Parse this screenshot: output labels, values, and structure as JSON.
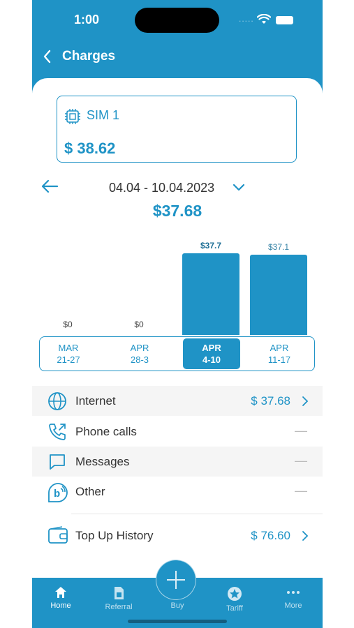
{
  "status_bar": {
    "time": "1:00",
    "dots": "....."
  },
  "header": {
    "title": "Charges"
  },
  "sim": {
    "name": "SIM 1",
    "balance": "$ 38.62"
  },
  "period": {
    "range": "04.04 - 10.04.2023",
    "total": "$37.68"
  },
  "chart_data": {
    "type": "bar",
    "categories": [
      "MAR 21-27",
      "APR 28-3",
      "APR 4-10",
      "APR 11-17"
    ],
    "values": [
      0,
      0,
      37.7,
      37.1
    ],
    "value_labels": [
      "$0",
      "$0",
      "$37.7",
      "$37.1"
    ],
    "selected_index": 2,
    "ylim": [
      0,
      37.7
    ]
  },
  "weeks": [
    {
      "month": "MAR",
      "days": "21-27"
    },
    {
      "month": "APR",
      "days": "28-3"
    },
    {
      "month": "APR",
      "days": "4-10"
    },
    {
      "month": "APR",
      "days": "11-17"
    }
  ],
  "charges": [
    {
      "label": "Internet",
      "value": "$ 37.68",
      "icon": "globe-icon"
    },
    {
      "label": "Phone calls",
      "value": "—",
      "icon": "phone-outgoing-icon"
    },
    {
      "label": "Messages",
      "value": "—",
      "icon": "message-icon"
    },
    {
      "label": "Other",
      "value": "—",
      "icon": "other-icon"
    }
  ],
  "top_up": {
    "label": "Top Up History",
    "value": "$ 76.60",
    "icon": "wallet-icon"
  },
  "tabs": [
    {
      "label": "Home",
      "icon": "home-icon"
    },
    {
      "label": "Referral",
      "icon": "sim-card-icon"
    },
    {
      "label": "Buy",
      "icon": "plus-icon"
    },
    {
      "label": "Tariff",
      "icon": "star-icon"
    },
    {
      "label": "More",
      "icon": "more-icon"
    }
  ],
  "colors": {
    "accent": "#1f93c6",
    "text": "#333333",
    "row_shade": "#f5f5f5"
  }
}
